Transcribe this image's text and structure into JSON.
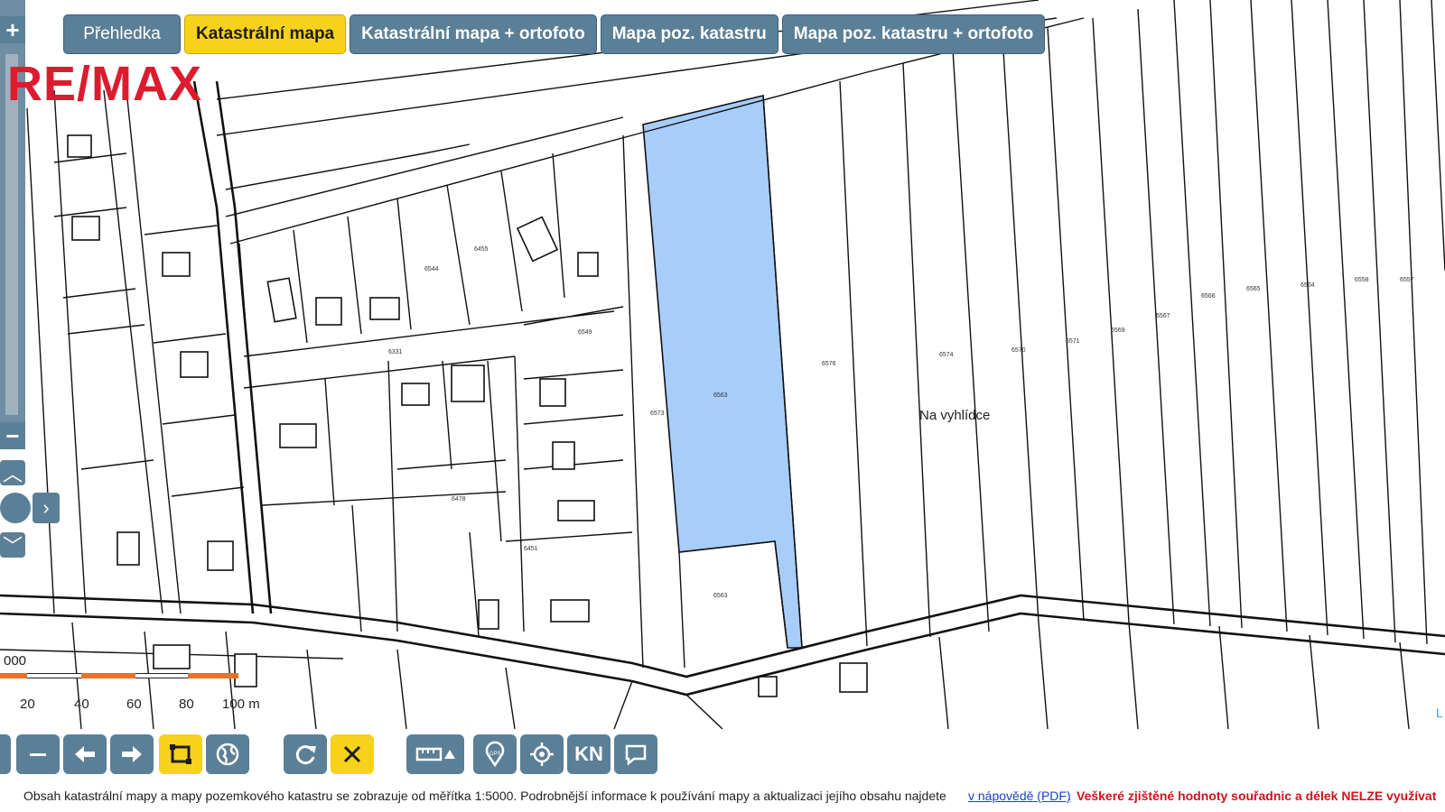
{
  "tabs": [
    {
      "label": "Přehledka",
      "active": false
    },
    {
      "label": "Katastrální mapa",
      "active": true
    },
    {
      "label": "Katastrální mapa + ortofoto",
      "active": false
    },
    {
      "label": "Mapa poz. katastru",
      "active": false
    },
    {
      "label": "Mapa poz. katastru + ortofoto",
      "active": false
    }
  ],
  "logo": "RE/MAX",
  "map": {
    "locality_label": "Na vyhlídce",
    "highlight_color": "#a7cdfb",
    "scale_labels": [
      "000",
      "20",
      "40",
      "60",
      "80",
      "100 m"
    ]
  },
  "zoom": {
    "in": "+",
    "out": "−"
  },
  "toolbar": {
    "buttons": [
      "zoom-out",
      "pan-left",
      "pan-right",
      "select-rectangle",
      "globe",
      "refresh",
      "clear",
      "measure",
      "gps",
      "locate",
      "kn",
      "feedback"
    ],
    "kn_label": "KN"
  },
  "footer": {
    "text": "Obsah katastrální mapy a mapy pozemkového katastru se zobrazuje od měřítka 1:5000. Podrobnější informace k používání mapy a aktualizaci jejího obsahu najdete",
    "link": "v nápovědě (PDF)",
    "link_suffix": ".",
    "warning": "Veškeré zjištěné hodnoty souřadnic a délek NELZE využívat"
  },
  "corner_tag": "L",
  "colors": {
    "tab": "#5b7f96",
    "tab_active": "#f6d21a",
    "logo": "#dc1c2e",
    "scale_orange": "#e8712b"
  }
}
